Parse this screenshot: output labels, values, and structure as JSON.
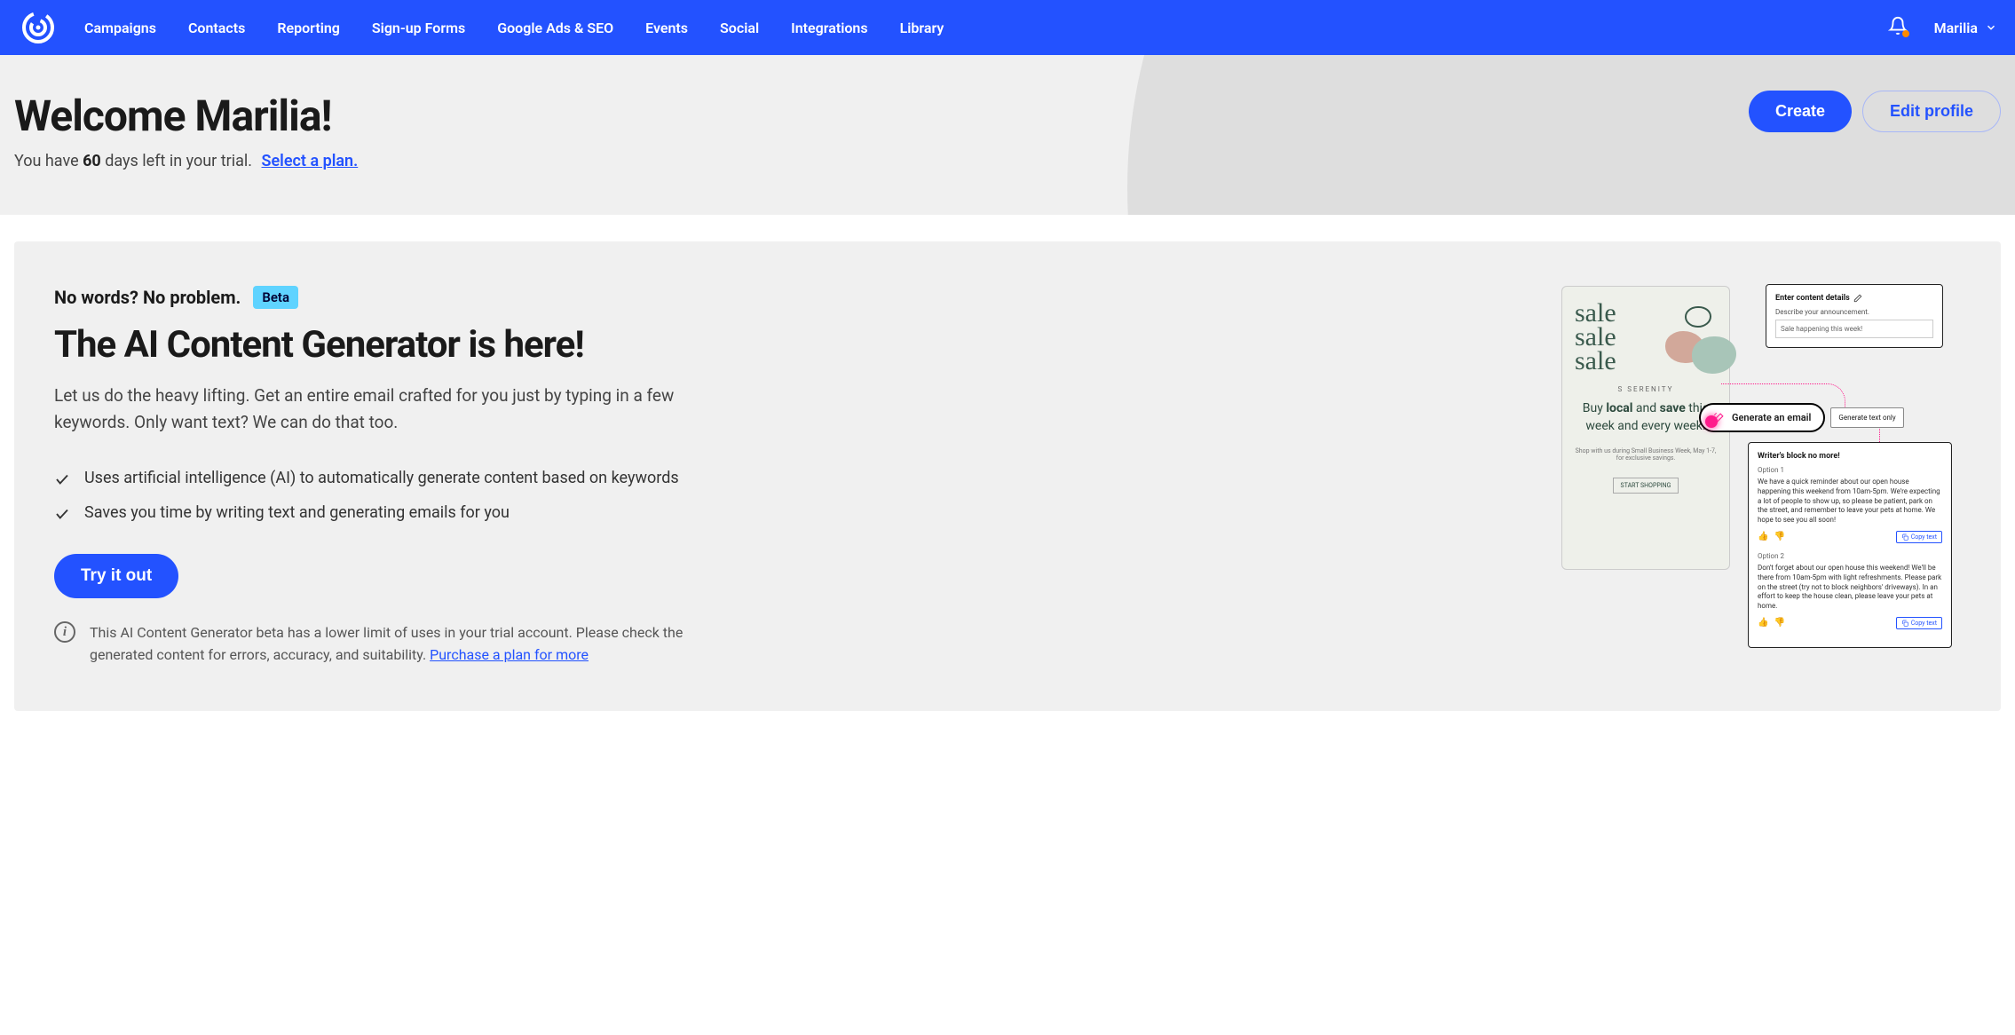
{
  "nav": {
    "items": [
      "Campaigns",
      "Contacts",
      "Reporting",
      "Sign-up Forms",
      "Google Ads & SEO",
      "Events",
      "Social",
      "Integrations",
      "Library"
    ],
    "user": "Marilia"
  },
  "hero": {
    "title": "Welcome Marilia!",
    "sub_prefix": "You have ",
    "days": "60",
    "sub_suffix": " days left in your trial.",
    "select_plan": "Select a plan.",
    "create_btn": "Create",
    "edit_btn": "Edit profile"
  },
  "card": {
    "tagline": "No words? No problem.",
    "beta": "Beta",
    "title": "The AI Content Generator is here!",
    "desc": "Let us do the heavy lifting. Get an entire email crafted for you just by typing in a few keywords. Only want text? We can do that too.",
    "features": [
      "Uses artificial intelligence (AI) to automatically generate content based on keywords",
      "Saves you time by writing text and generating emails for you"
    ],
    "try_btn": "Try it out",
    "disclaimer": "This AI Content Generator beta has a lower limit of uses in your trial account. Please check the generated content for errors, accuracy, and suitability. ",
    "disclaimer_link": "Purchase a plan for more"
  },
  "preview": {
    "sale": "sale\nsale\nsale",
    "brand": "S SERENITY",
    "buy_local_1": "Buy ",
    "buy_local_2": "local",
    "buy_local_3": " and ",
    "buy_local_4": "save",
    "buy_local_5": " this week and every week.",
    "shop_text": "Shop with us during Small Business Week, May 1-7, for exclusive savings.",
    "shop_btn": "START SHOPPING",
    "panel_top_title": "Enter content details",
    "panel_top_label": "Describe your announcement.",
    "panel_top_input": "Sale happening this week!",
    "pill_main": "Generate an email",
    "pill_alt": "Generate text only",
    "panel_bottom_title": "Writer's block no more!",
    "option1_label": "Option 1",
    "option1_text": "We have a quick reminder about our open house happening this weekend from 10am-5pm. We're expecting a lot of people to show up, so please be patient, park on the street, and remember to leave your pets at home. We hope to see you all soon!",
    "option2_label": "Option 2",
    "option2_text": "Don't forget about our open house this weekend! We'll be there from 10am-5pm with light refreshments. Please park on the street (try not to block neighbors' driveways). In an effort to keep the house clean, please leave your pets at home.",
    "copy": "Copy text"
  }
}
